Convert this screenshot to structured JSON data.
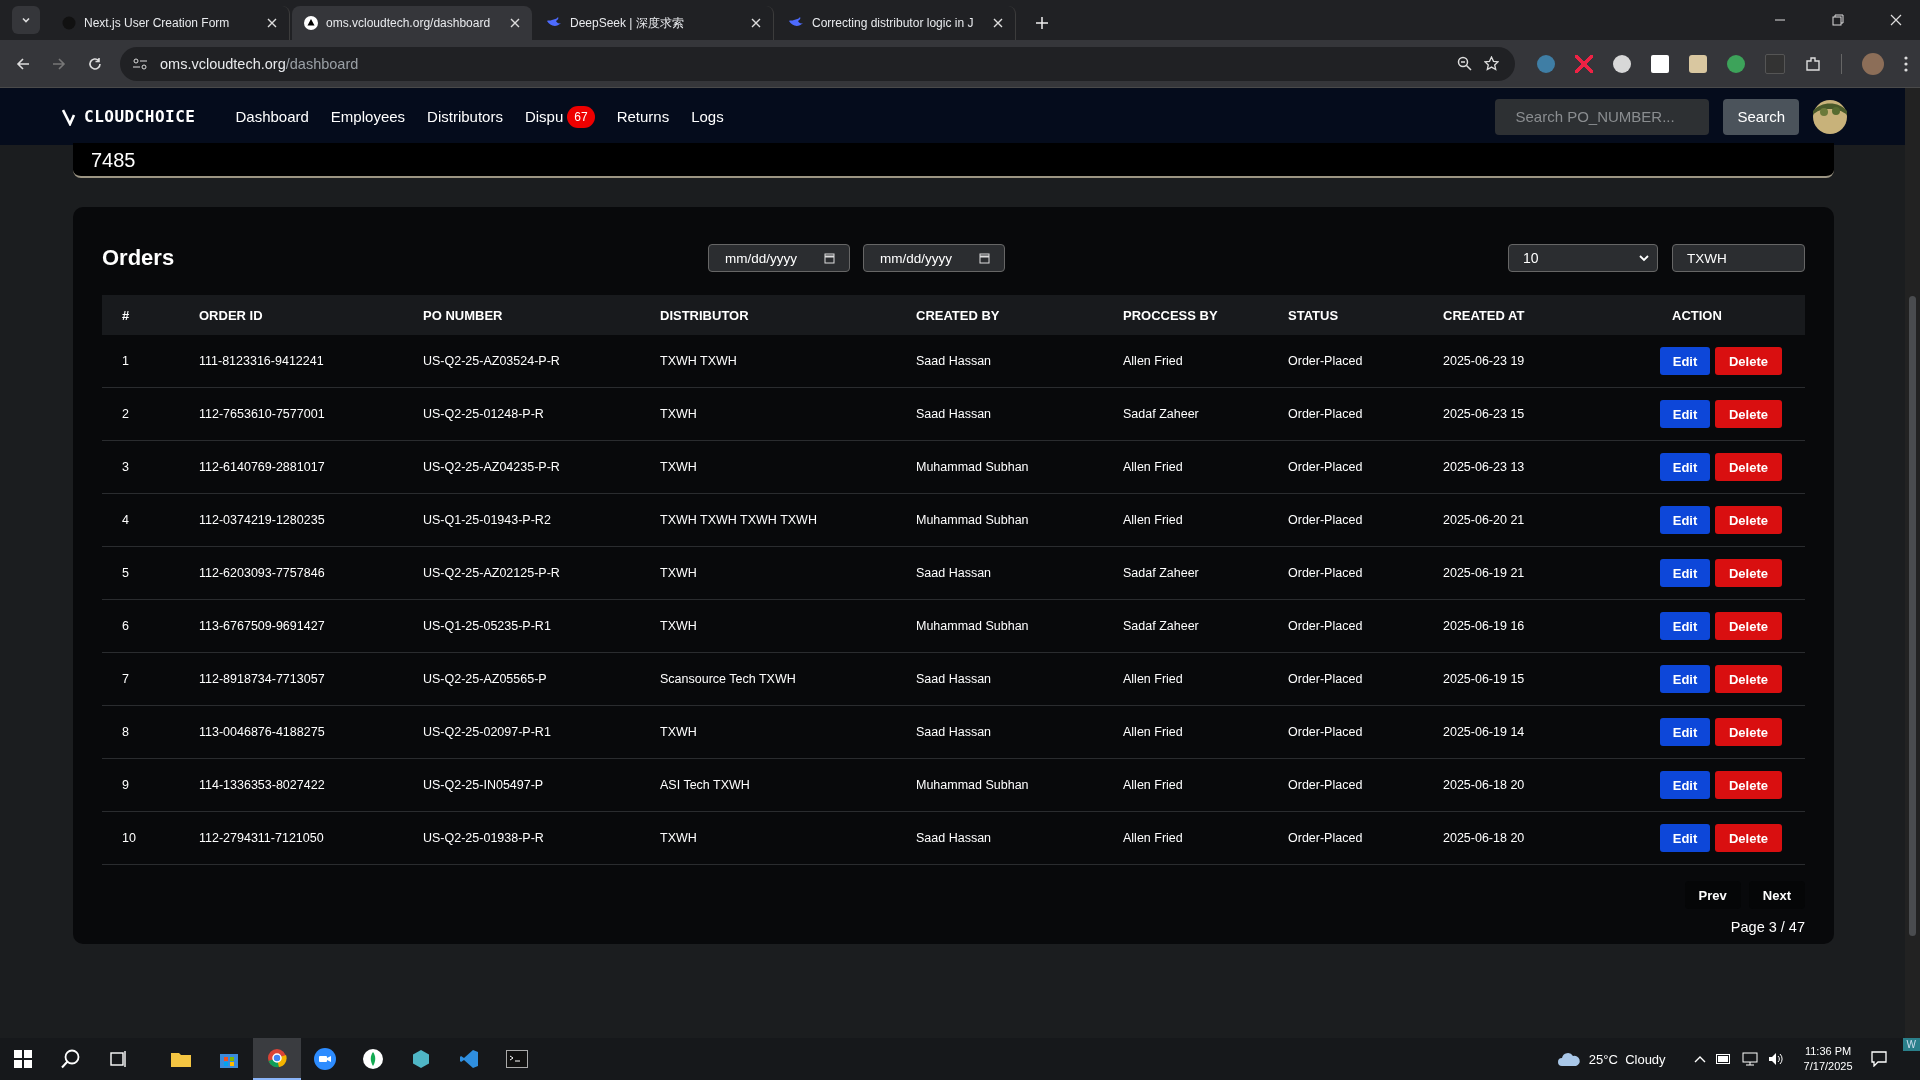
{
  "browser": {
    "tabs": [
      {
        "title": "Next.js User Creation Form",
        "selected": false
      },
      {
        "title": "oms.vcloudtech.org/dashboard",
        "selected": true
      },
      {
        "title": "DeepSeek | 深度求索",
        "selected": false
      },
      {
        "title": "Correcting distributor logic in J",
        "selected": false
      }
    ],
    "address": {
      "host": "oms.vcloudtech.org",
      "path": "/dashboard"
    }
  },
  "navbar": {
    "logo": "CLOUDCHOICE",
    "links": [
      {
        "label": "Dashboard"
      },
      {
        "label": "Employees"
      },
      {
        "label": "Distributors"
      },
      {
        "label": "Dispu",
        "badge": "67"
      },
      {
        "label": "Returns"
      },
      {
        "label": "Logs"
      }
    ],
    "search": {
      "placeholder": "Search PO_NUMBER..."
    },
    "search_button": "Search"
  },
  "previous_card": {
    "value": "7485"
  },
  "orders": {
    "title": "Orders",
    "date_from": {
      "placeholder": "mm/dd/yyyy"
    },
    "date_to": {
      "placeholder": "mm/dd/yyyy"
    },
    "page_size": "10",
    "filter": {
      "value": "TXWH"
    },
    "columns": [
      "#",
      "ORDER ID",
      "PO NUMBER",
      "DISTRIBUTOR",
      "CREATED BY",
      "PROCCESS BY",
      "STATUS",
      "CREATED AT",
      "ACTION"
    ],
    "rows": [
      [
        "1",
        "111-8123316-9412241",
        "US-Q2-25-AZ03524-P-R",
        "TXWH TXWH",
        "Saad Hassan",
        "Allen Fried",
        "Order-Placed",
        "2025-06-23 19"
      ],
      [
        "2",
        "112-7653610-7577001",
        "US-Q2-25-01248-P-R",
        "TXWH",
        "Saad Hassan",
        "Sadaf Zaheer",
        "Order-Placed",
        "2025-06-23 15"
      ],
      [
        "3",
        "112-6140769-2881017",
        "US-Q2-25-AZ04235-P-R",
        "TXWH",
        "Muhammad Subhan",
        "Allen Fried",
        "Order-Placed",
        "2025-06-23 13"
      ],
      [
        "4",
        "112-0374219-1280235",
        "US-Q1-25-01943-P-R2",
        "TXWH TXWH TXWH TXWH",
        "Muhammad Subhan",
        "Allen Fried",
        "Order-Placed",
        "2025-06-20 21"
      ],
      [
        "5",
        "112-6203093-7757846",
        "US-Q2-25-AZ02125-P-R",
        "TXWH",
        "Saad Hassan",
        "Sadaf Zaheer",
        "Order-Placed",
        "2025-06-19 21"
      ],
      [
        "6",
        "113-6767509-9691427",
        "US-Q1-25-05235-P-R1",
        "TXWH",
        "Muhammad Subhan",
        "Sadaf Zaheer",
        "Order-Placed",
        "2025-06-19 16"
      ],
      [
        "7",
        "112-8918734-7713057",
        "US-Q2-25-AZ05565-P",
        "Scansource Tech TXWH",
        "Saad Hassan",
        "Allen Fried",
        "Order-Placed",
        "2025-06-19 15"
      ],
      [
        "8",
        "113-0046876-4188275",
        "US-Q2-25-02097-P-R1",
        "TXWH",
        "Saad Hassan",
        "Allen Fried",
        "Order-Placed",
        "2025-06-19 14"
      ],
      [
        "9",
        "114-1336353-8027422",
        "US-Q2-25-IN05497-P",
        "ASI Tech TXWH",
        "Muhammad Subhan",
        "Allen Fried",
        "Order-Placed",
        "2025-06-18 20"
      ],
      [
        "10",
        "112-2794311-7121050",
        "US-Q2-25-01938-P-R",
        "TXWH",
        "Saad Hassan",
        "Allen Fried",
        "Order-Placed",
        "2025-06-18 20"
      ]
    ],
    "row_actions": [
      [
        "Edit",
        "Delete"
      ],
      [
        "Edit",
        "Delete"
      ],
      [
        "Edit",
        "Delete"
      ],
      [
        "Edit",
        "Delete"
      ],
      [
        "Edit",
        "Delete"
      ],
      [
        "Edit",
        "Delete"
      ],
      [
        "Edit",
        "Delete"
      ],
      [
        "Edit",
        "Delete"
      ],
      [
        "Edit",
        "Delete"
      ],
      [
        "Edit",
        "Delete"
      ]
    ],
    "prev": "Prev",
    "next": "Next",
    "page_info": "Page 3 / 47"
  },
  "taskbar": {
    "weather": "25°C  Cloudy",
    "time": "11:36 PM",
    "date": "7/17/2025",
    "corner": "W"
  }
}
